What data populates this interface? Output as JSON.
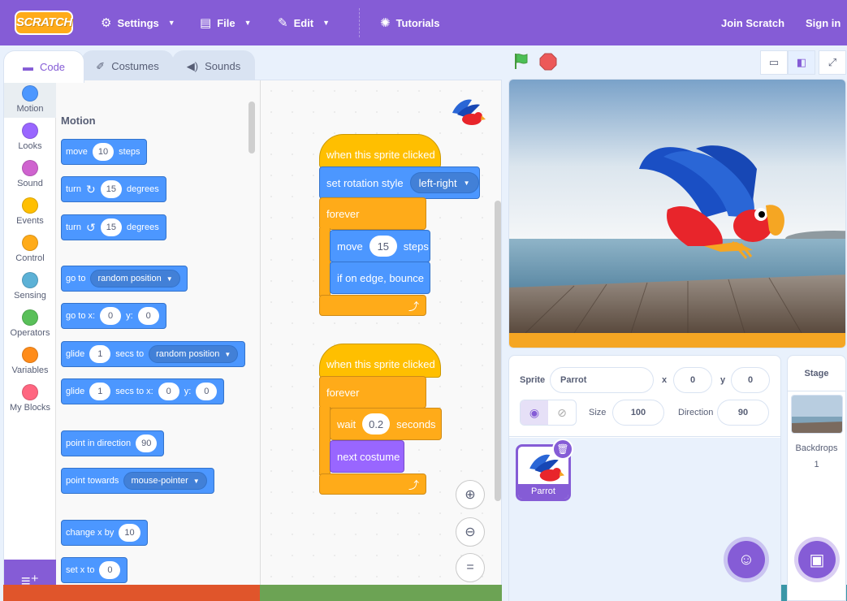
{
  "menu": {
    "logo": "SCRATCH",
    "settings": "Settings",
    "file": "File",
    "edit": "Edit",
    "tutorials": "Tutorials",
    "join": "Join Scratch",
    "signin": "Sign in"
  },
  "tabs": {
    "code": "Code",
    "costumes": "Costumes",
    "sounds": "Sounds"
  },
  "categories": [
    {
      "label": "Motion",
      "color": "#4c97ff"
    },
    {
      "label": "Looks",
      "color": "#9966ff"
    },
    {
      "label": "Sound",
      "color": "#cf63cf"
    },
    {
      "label": "Events",
      "color": "#ffbf00"
    },
    {
      "label": "Control",
      "color": "#ffab19"
    },
    {
      "label": "Sensing",
      "color": "#5cb1d6"
    },
    {
      "label": "Operators",
      "color": "#59c059"
    },
    {
      "label": "Variables",
      "color": "#ff8c1a"
    },
    {
      "label": "My Blocks",
      "color": "#ff6680"
    }
  ],
  "palette": {
    "title": "Motion",
    "move": {
      "a": "move",
      "v": "10",
      "b": "steps"
    },
    "turn_right": {
      "a": "turn",
      "v": "15",
      "b": "degrees"
    },
    "turn_left": {
      "a": "turn",
      "v": "15",
      "b": "degrees"
    },
    "goto": {
      "a": "go to",
      "d": "random position"
    },
    "goto_xy": {
      "a": "go to x:",
      "x": "0",
      "b": "y:",
      "y": "0"
    },
    "glide": {
      "a": "glide",
      "v": "1",
      "b": "secs to",
      "d": "random position"
    },
    "glide_xy": {
      "a": "glide",
      "v": "1",
      "b": "secs to x:",
      "x": "0",
      "c": "y:",
      "y": "0"
    },
    "point_dir": {
      "a": "point in direction",
      "v": "90"
    },
    "point_towards": {
      "a": "point towards",
      "d": "mouse-pointer"
    },
    "change_x": {
      "a": "change x by",
      "v": "10"
    },
    "set_x": {
      "a": "set x to",
      "v": "0"
    }
  },
  "script1": {
    "hat": "when this sprite clicked",
    "rotation": "set rotation style",
    "rotation_value": "left-right",
    "forever": "forever",
    "move_a": "move",
    "move_v": "15",
    "move_b": "steps",
    "bounce": "if on edge, bounce"
  },
  "script2": {
    "hat": "when this sprite clicked",
    "forever": "forever",
    "wait_a": "wait",
    "wait_v": "0.2",
    "wait_b": "seconds",
    "costume": "next costume"
  },
  "sprite_info": {
    "sprite_label": "Sprite",
    "sprite_name": "Parrot",
    "x_label": "x",
    "x": "0",
    "y_label": "y",
    "y": "0",
    "size_label": "Size",
    "size": "100",
    "direction_label": "Direction",
    "direction": "90"
  },
  "sprites": [
    {
      "name": "Parrot"
    }
  ],
  "stage_pane": {
    "title": "Stage",
    "backdrops_label": "Backdrops",
    "backdrops_count": "1"
  },
  "colors": {
    "accent": "#855cd6",
    "motion": "#4c97ff",
    "events": "#ffbf00",
    "control": "#ffab19",
    "looks": "#9966ff"
  }
}
